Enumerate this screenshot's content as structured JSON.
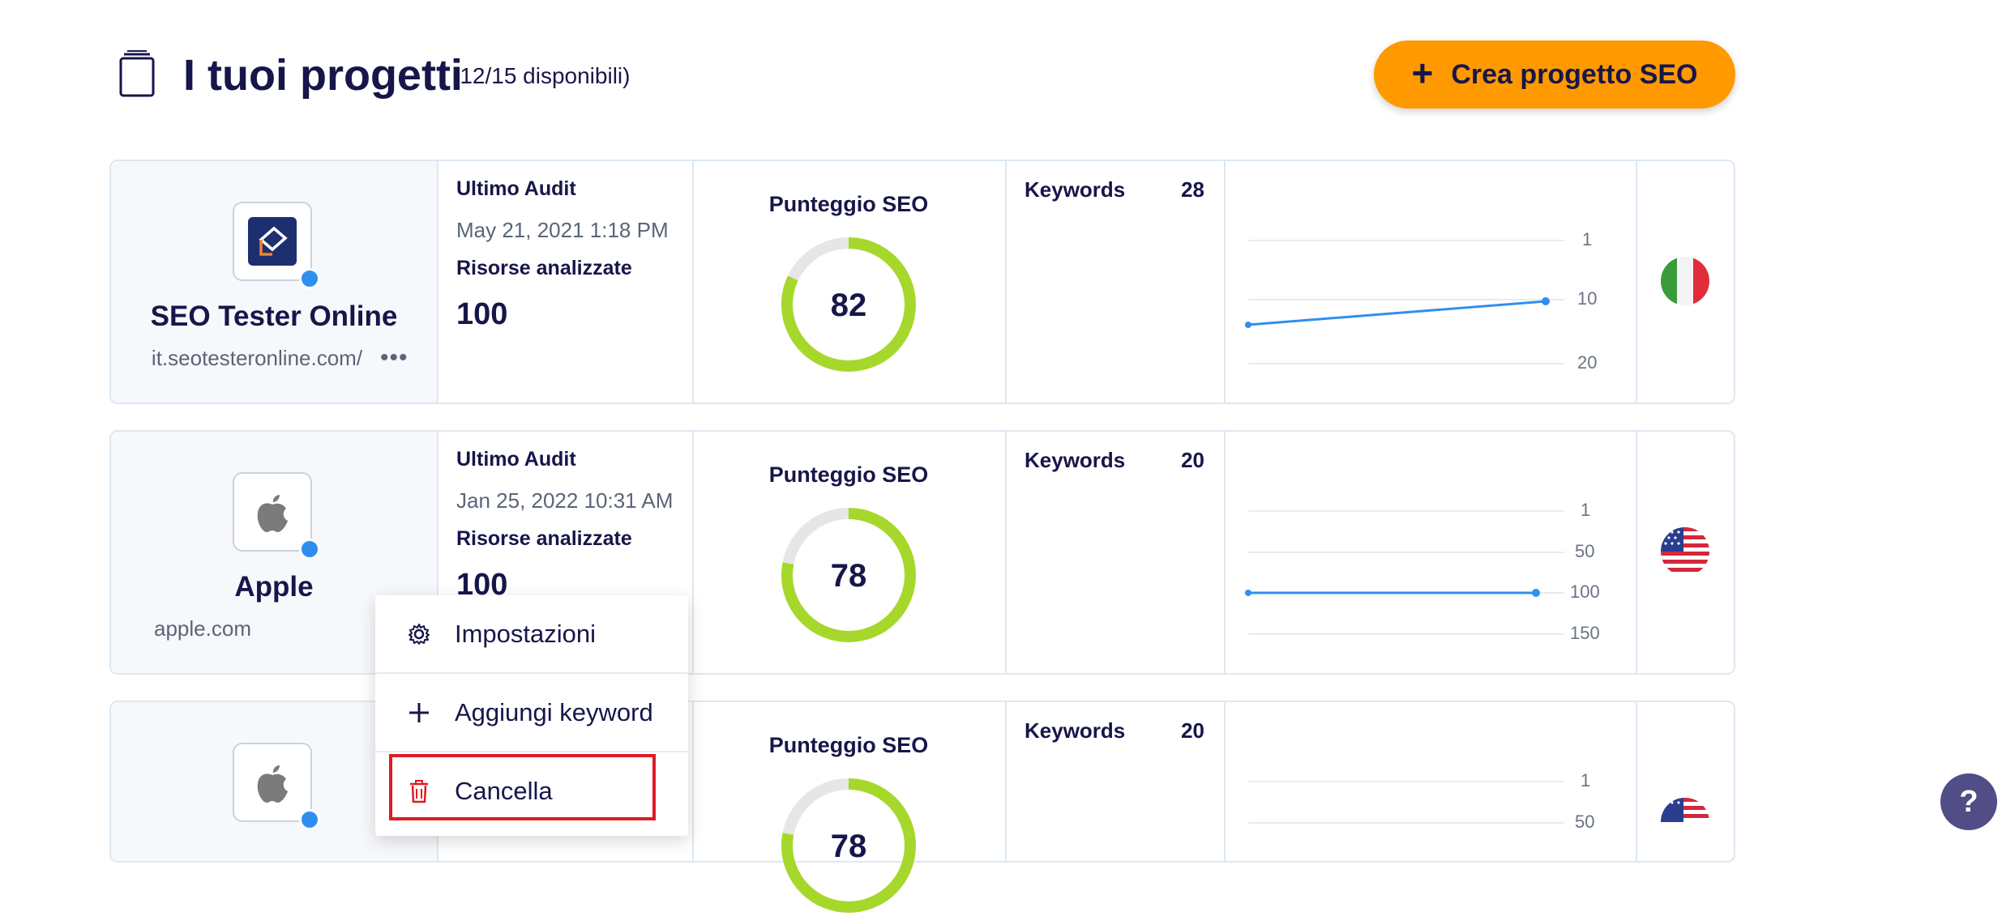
{
  "header": {
    "title": "I tuoi progetti",
    "subtitle": "(12/15 disponibili)",
    "create_button": "Crea progetto SEO",
    "create_icon": "+"
  },
  "projects": [
    {
      "name": "SEO Tester Online",
      "url": "it.seotesteronline.com/",
      "logo": "seotesteronline-logo",
      "last_audit_label": "Ultimo Audit",
      "last_audit": "May 21, 2021 1:18 PM",
      "resources_label": "Risorse analizzate",
      "resources": "100",
      "score_label": "Punteggio SEO",
      "score": "82",
      "score_value": 82,
      "keywords_label": "Keywords",
      "keywords": "28",
      "rank_ticks": [
        "1",
        "10",
        "20"
      ],
      "rank_series": [
        12,
        10
      ],
      "flag": "italy-flag"
    },
    {
      "name": "Apple",
      "url": "apple.com",
      "logo": "apple-logo",
      "last_audit_label": "Ultimo Audit",
      "last_audit": "Jan 25, 2022 10:31 AM",
      "resources_label": "Risorse analizzate",
      "resources": "100",
      "score_label": "Punteggio SEO",
      "score": "78",
      "score_value": 78,
      "keywords_label": "Keywords",
      "keywords": "20",
      "rank_ticks": [
        "1",
        "50",
        "100",
        "150"
      ],
      "rank_series": [
        100,
        100
      ],
      "flag": "usa-flag"
    },
    {
      "logo": "apple-logo",
      "score_label": "Punteggio SEO",
      "score": "78",
      "score_value": 78,
      "keywords_label": "Keywords",
      "keywords": "20",
      "rank_ticks": [
        "1",
        "50"
      ],
      "flag": "usa-flag"
    }
  ],
  "context_menu": {
    "items": [
      {
        "label": "Impostazioni",
        "icon": "gear-icon"
      },
      {
        "label": "Aggiungi keyword",
        "icon": "plus-icon"
      },
      {
        "label": "Cancella",
        "icon": "trash-icon"
      }
    ]
  },
  "help_button": "?",
  "colors": {
    "accent": "#ff9900",
    "score_ring": "#a6d82b",
    "rank_line": "#2f8ff0",
    "danger": "#e01b24"
  }
}
